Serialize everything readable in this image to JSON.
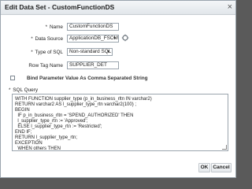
{
  "dialog": {
    "title": "Edit Data Set - CustomFunctionDS",
    "close_glyph": "×"
  },
  "form": {
    "name": {
      "label": "Name",
      "value": "CustomFunctionDS"
    },
    "data_source": {
      "label": "Data Source",
      "value": "ApplicationDB_FSCM"
    },
    "type_of_sql": {
      "label": "Type of SQL",
      "value": "Non-standard SQL"
    },
    "row_tag_name": {
      "label": "Row Tag Name",
      "value": "SUPPLIER_DET"
    },
    "bind_parameter": {
      "label": "Bind Parameter Value As Comma Separated String",
      "checked": false
    },
    "sql_query": {
      "label": "SQL Query",
      "value": "WITH FUNCTION supplier_type (p_in_business_rltn IN varchar2)\nRETURN varchar2 AS l_supplier_type_rtn varchar2(100) ;\nBEGIN\n  IF p_in_business_rltn = 'SPEND_AUTHORIZED' THEN\n  l_supplier_type_rtn := 'Approved';\n  ELSE l_supplier_type_rtn := 'Restricted';\nEND IF;\nRETURN l_supplier_type_rtn;\nEXCEPTION\n  WHEN others THEN\n   RETURN 'NA';\nEND;\nSELECT vendor_name"
    },
    "required_mark": "*"
  },
  "buttons": {
    "ok": "OK",
    "cancel": "Cancel"
  }
}
